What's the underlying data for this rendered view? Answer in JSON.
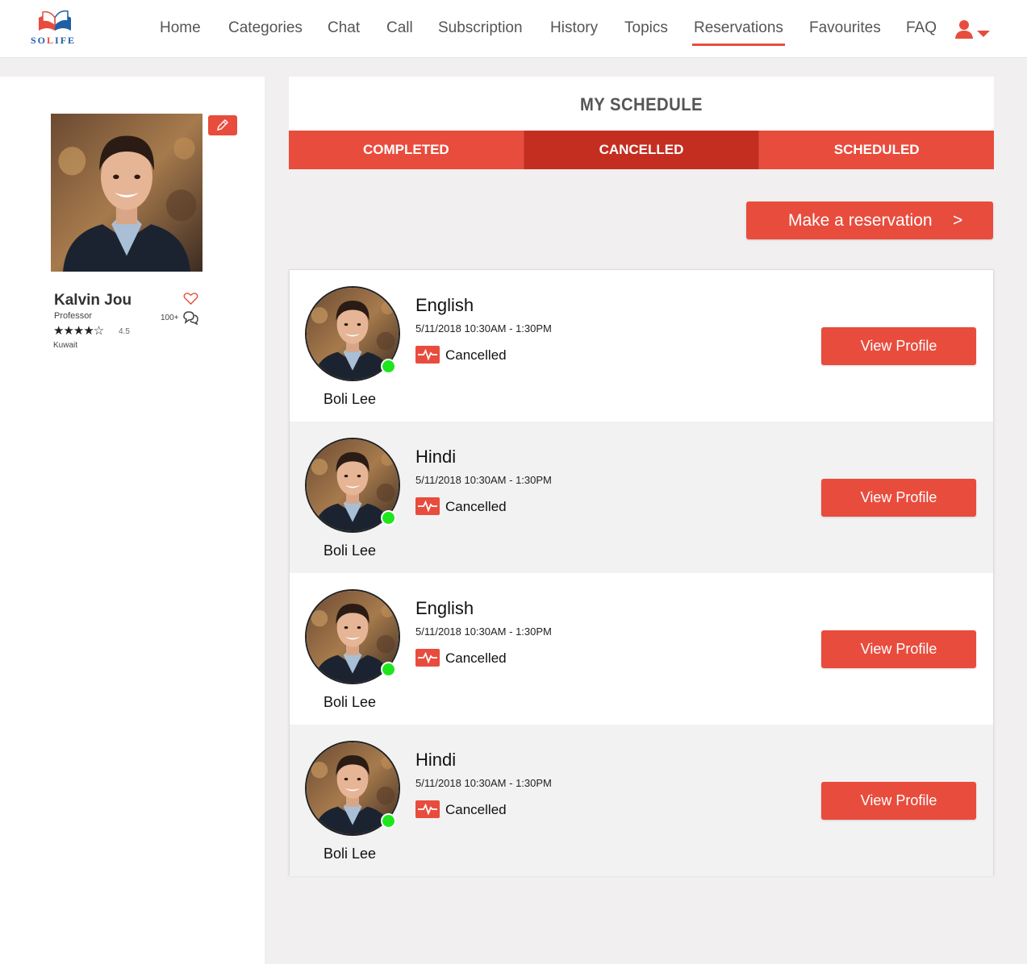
{
  "brand": {
    "logo_text_blue": "SO",
    "logo_text_red": "L",
    "logo_text_rest": "IFE",
    "primary_color": "#e84c3d",
    "primary_dark": "#c42e20",
    "online_color": "#1ee61e"
  },
  "nav": {
    "items": [
      {
        "label": "Home"
      },
      {
        "label": "Categories"
      },
      {
        "label": "Chat"
      },
      {
        "label": "Call"
      },
      {
        "label": "Subscription"
      },
      {
        "label": "History"
      },
      {
        "label": "Topics"
      },
      {
        "label": "Reservations",
        "active": true
      },
      {
        "label": "Favourites"
      },
      {
        "label": "FAQ"
      }
    ],
    "user_icon": "user-icon",
    "dropdown_icon": "caret-down-icon"
  },
  "profile": {
    "name": "Kalvin Jou",
    "title": "Professor",
    "stars": "★★★★☆",
    "rating": "4.5",
    "location": "Kuwait",
    "review_count": "100+",
    "edit_icon": "pencil-icon",
    "favourite_icon": "heart-icon",
    "chat_icon": "chat-bubbles-icon"
  },
  "schedule": {
    "title": "MY SCHEDULE",
    "tabs": [
      {
        "label": "COMPLETED"
      },
      {
        "label": "CANCELLED",
        "active": true
      },
      {
        "label": "SCHEDULED"
      }
    ],
    "reserve_label": "Make a reservation",
    "reserve_arrow": ">"
  },
  "sessions": [
    {
      "tutor": "Boli Lee",
      "language": "English",
      "time": "5/11/2018 10:30AM - 1:30PM",
      "status": "Cancelled",
      "action": "View Profile",
      "online": true
    },
    {
      "tutor": "Boli Lee",
      "language": "Hindi",
      "time": "5/11/2018 10:30AM - 1:30PM",
      "status": "Cancelled",
      "action": "View Profile",
      "online": true
    },
    {
      "tutor": "Boli Lee",
      "language": "English",
      "time": "5/11/2018 10:30AM - 1:30PM",
      "status": "Cancelled",
      "action": "View Profile",
      "online": true
    },
    {
      "tutor": "Boli Lee",
      "language": "Hindi",
      "time": "5/11/2018 10:30AM - 1:30PM",
      "status": "Cancelled",
      "action": "View Profile",
      "online": true
    }
  ]
}
